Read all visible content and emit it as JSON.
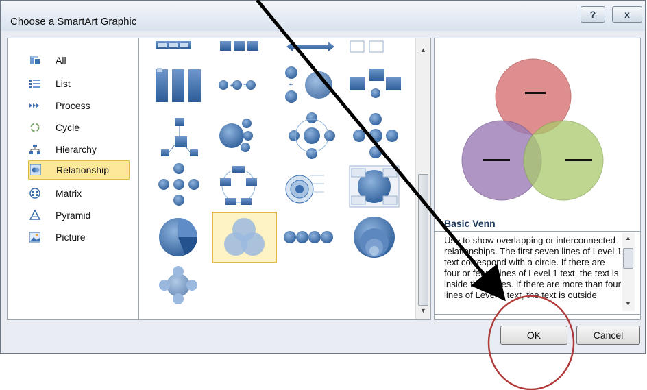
{
  "window": {
    "title": "Choose a SmartArt Graphic",
    "help_label": "?",
    "close_label": "x"
  },
  "categories": [
    {
      "label": "All",
      "icon": "all-icon"
    },
    {
      "label": "List",
      "icon": "list-icon"
    },
    {
      "label": "Process",
      "icon": "process-icon"
    },
    {
      "label": "Cycle",
      "icon": "cycle-icon"
    },
    {
      "label": "Hierarchy",
      "icon": "hierarchy-icon"
    },
    {
      "label": "Relationship",
      "icon": "relationship-icon",
      "selected": true
    },
    {
      "label": "Matrix",
      "icon": "matrix-icon"
    },
    {
      "label": "Pyramid",
      "icon": "pyramid-icon"
    },
    {
      "label": "Picture",
      "icon": "picture-icon"
    }
  ],
  "preview": {
    "name": "Basic Venn",
    "description": "Use to show overlapping or interconnected relationships. The first seven lines of Level 1 text correspond with a circle. If there are four or fewer lines of Level 1 text, the text is inside the circles. If there are more than four lines of Level 1 text, the text is outside"
  },
  "buttons": {
    "ok": "OK",
    "cancel": "Cancel"
  },
  "colors": {
    "selection": "#fde89a",
    "annotation": "#b03a3a",
    "venn_red": "#d97b7b",
    "venn_purple": "#9b7bb5",
    "venn_green": "#a9c96b"
  }
}
